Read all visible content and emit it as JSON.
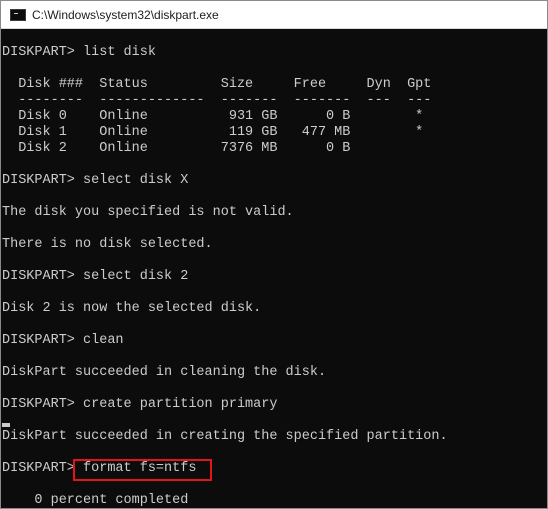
{
  "window": {
    "title": "C:\\Windows\\system32\\diskpart.exe",
    "icon": "console-icon"
  },
  "console": {
    "lines": [
      "DISKPART> list disk",
      "",
      "  Disk ###  Status         Size     Free     Dyn  Gpt",
      "  --------  -------------  -------  -------  ---  ---",
      "  Disk 0    Online          931 GB      0 B        *",
      "  Disk 1    Online          119 GB   477 MB        *",
      "  Disk 2    Online         7376 MB      0 B",
      "",
      "DISKPART> select disk X",
      "",
      "The disk you specified is not valid.",
      "",
      "There is no disk selected.",
      "",
      "DISKPART> select disk 2",
      "",
      "Disk 2 is now the selected disk.",
      "",
      "DISKPART> clean",
      "",
      "DiskPart succeeded in cleaning the disk.",
      "",
      "DISKPART> create partition primary",
      "",
      "DiskPart succeeded in creating the specified partition.",
      "",
      "DISKPART> format fs=ntfs",
      "",
      "    0 percent completed"
    ]
  },
  "colors": {
    "console_background": "#0c0c0c",
    "console_text": "#cccccc",
    "highlight": "#e0161b"
  }
}
